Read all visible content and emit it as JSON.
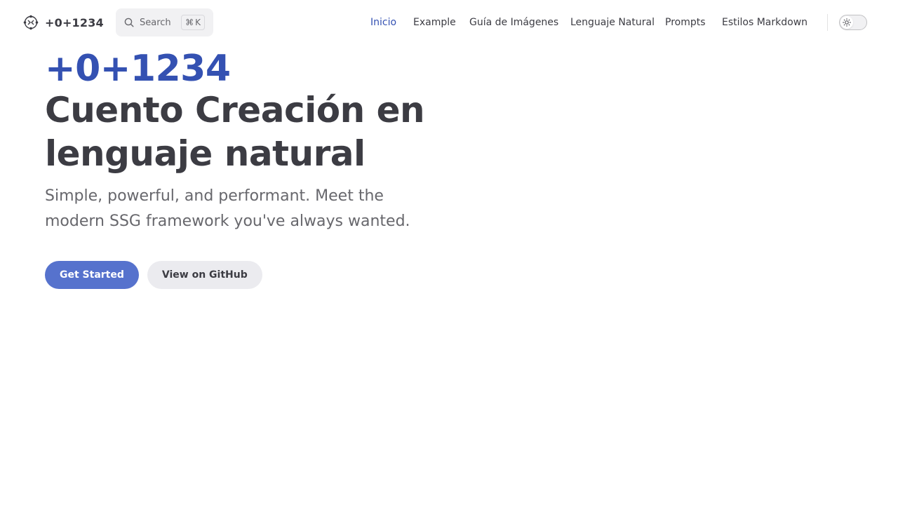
{
  "brand": {
    "name": "+0+1234",
    "logo_icon": "logo-icon"
  },
  "search": {
    "label": "Search",
    "shortcut_symbol": "⌘",
    "shortcut_key": "K",
    "icon": "search-icon"
  },
  "nav": {
    "items": [
      {
        "label": "Inicio",
        "active": true
      },
      {
        "label": "Example",
        "active": false
      },
      {
        "label": "Guía de Imágenes",
        "active": false
      },
      {
        "label": "Lenguaje Natural",
        "active": false
      },
      {
        "label": "Prompts",
        "active": false
      },
      {
        "label": "Estilos Markdown",
        "active": false
      }
    ],
    "theme_toggle_icon": "sun-icon"
  },
  "hero": {
    "name": "+0+1234",
    "text_line1": "Cuento Creación en",
    "text_line2": "lenguaje natural",
    "tagline": "Simple, powerful, and performant. Meet the modern SSG framework you've always wanted."
  },
  "actions": {
    "primary_label": "Get Started",
    "secondary_label": "View on GitHub"
  },
  "colors": {
    "brand": "#3451b2",
    "button_brand": "#5672cd",
    "text": "#3c3c43",
    "text_muted": "#67676c",
    "button_alt_bg": "#ebebef"
  }
}
